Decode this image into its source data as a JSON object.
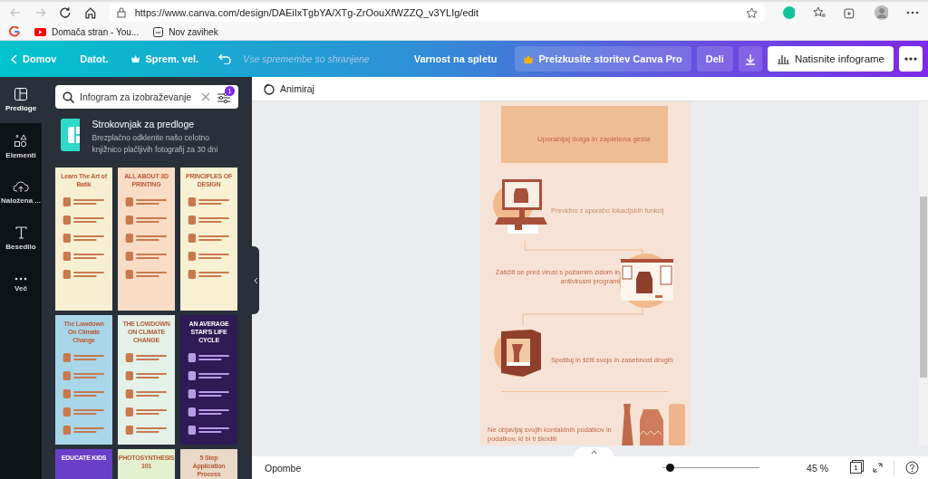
{
  "browser": {
    "url": "https://www.canva.com/design/DAEiIxTgbYA/XTg-ZrOouXfWZZQ_v3YLIg/edit",
    "bookmarks": [
      {
        "label": "Domača stran - You..."
      },
      {
        "label": "Nov zavihek"
      }
    ]
  },
  "header": {
    "home": "Domov",
    "menus": [
      "Datot.",
      "Sprem. vel."
    ],
    "saved_status": "Vse spremembe so shranjene",
    "doc_title": "Varnost na spletu",
    "pro_button": "Preizkusite storitev Canva Pro",
    "share_button": "Deli",
    "print_button": "Natisnite infograme"
  },
  "rail": [
    {
      "label": "Predloge",
      "selected": true
    },
    {
      "label": "Elementi",
      "selected": false
    },
    {
      "label": "Naložena ...",
      "selected": false
    },
    {
      "label": "Besedilo",
      "selected": false
    },
    {
      "label": "Več",
      "selected": false
    }
  ],
  "panel": {
    "search": {
      "value": "Infogram za izobraževanje",
      "filter_count": "1"
    },
    "promo": {
      "title": "Strokovnjak za predloge",
      "text": "Brezplačno odklenite našo celotno knjižnico plačljivih fotografij za 30 dni"
    },
    "templates": [
      {
        "title": "Learn The Art of Batik",
        "color": "#f6efd2"
      },
      {
        "title": "ALL ABOUT 3D PRINTING",
        "color": "#f8dcc6"
      },
      {
        "title": "PRINCIPLES OF DESIGN",
        "color": "#f7f0d2"
      },
      {
        "title": "The Lowdown On Climate Change",
        "color": "#a9d6e8"
      },
      {
        "title": "THE LOWDOWN ON CLIMATE CHANGE",
        "color": "#e3f1e8"
      },
      {
        "title": "AN AVERAGE STAR'S LIFE CYCLE",
        "color": "#2e1a55"
      },
      {
        "title": "EDUCATE KIDS",
        "color": "#6a3fc8"
      },
      {
        "title": "PHOTOSYNTHESIS 101",
        "color": "#e4f0cf"
      },
      {
        "title": "5 Step Application Process",
        "color": "#ead8c8"
      }
    ]
  },
  "toolbar": {
    "animate": "Animiraj"
  },
  "design": {
    "steps": [
      "Uporabljaj dolga in zapletena gesla",
      "Previdno z uporabo lokacijskih funkcij",
      "Zaščiti se pred virusi s požarnim zidom in antivirusni programi",
      "Spoštuj in ščiti svojo in zasebnost drugih",
      "Ne objavljaj svojih kontaktnih podatkov in podatkov, ki bi ti škodili"
    ]
  },
  "footer": {
    "notes": "Opombe",
    "zoom": {
      "level": 0.07,
      "reading": "45 %"
    },
    "page_count": "1"
  }
}
